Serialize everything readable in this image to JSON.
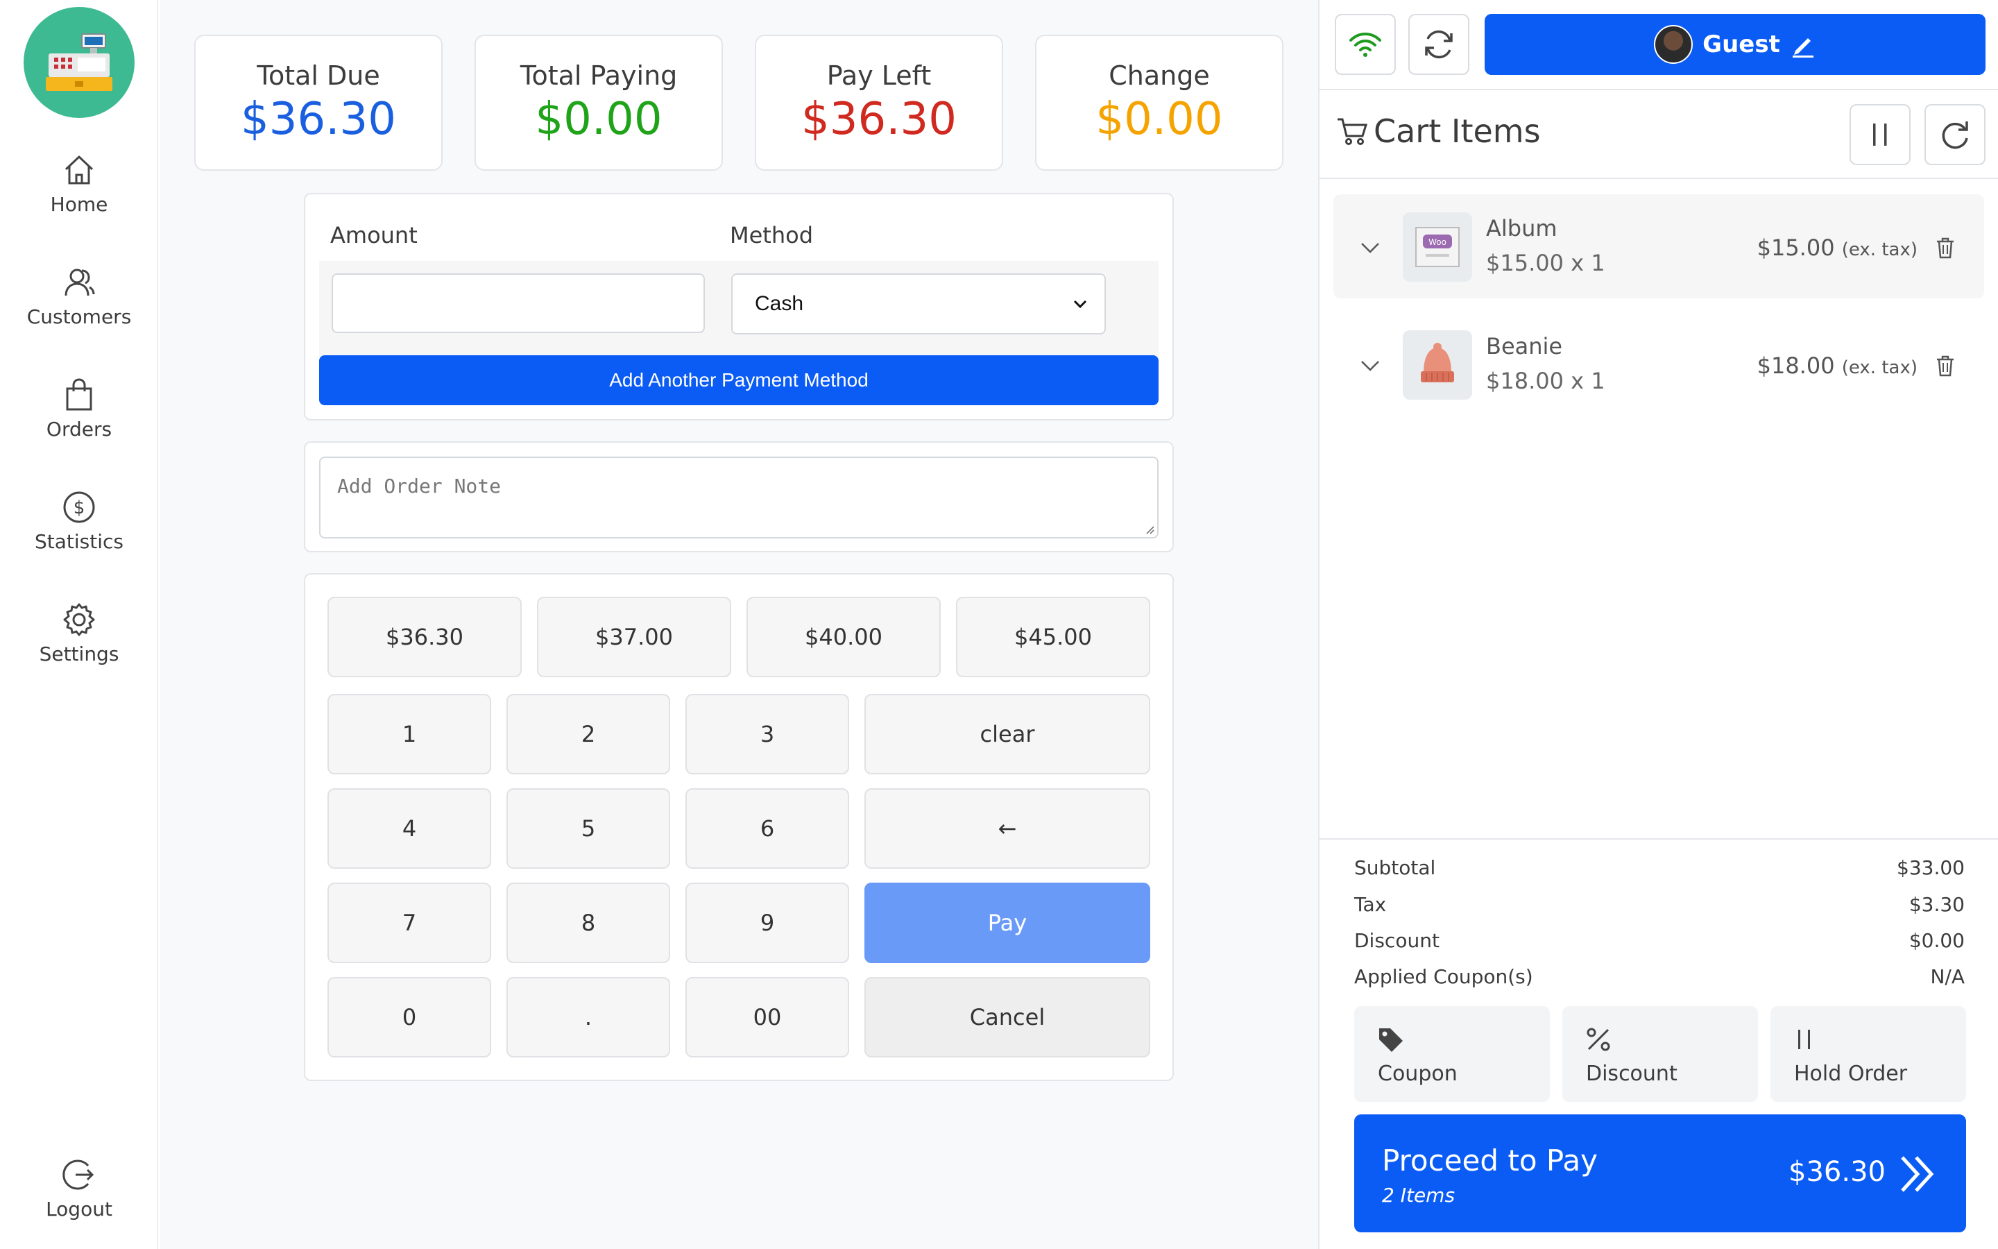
{
  "nav": {
    "items": [
      {
        "label": "Home"
      },
      {
        "label": "Customers"
      },
      {
        "label": "Orders"
      },
      {
        "label": "Statistics"
      },
      {
        "label": "Settings"
      }
    ],
    "logout": "Logout"
  },
  "summary": [
    {
      "label": "Total Due",
      "value": "$36.30",
      "color": "#1a5fe0"
    },
    {
      "label": "Total Paying",
      "value": "$0.00",
      "color": "#1fa319"
    },
    {
      "label": "Pay Left",
      "value": "$36.30",
      "color": "#d02a20"
    },
    {
      "label": "Change",
      "value": "$0.00",
      "color": "#f5a300"
    }
  ],
  "payment": {
    "amount_label": "Amount",
    "method_label": "Method",
    "amount_value": "",
    "method_selected": "Cash",
    "add_method_label": "Add Another Payment Method"
  },
  "order_note": {
    "placeholder": "Add Order Note"
  },
  "quick_amounts": [
    "$36.30",
    "$37.00",
    "$40.00",
    "$45.00"
  ],
  "keypad": {
    "digits": [
      "1",
      "2",
      "3",
      "4",
      "5",
      "6",
      "7",
      "8",
      "9",
      "0",
      ".",
      "00"
    ],
    "clear": "clear",
    "backspace": "←",
    "pay": "Pay",
    "cancel": "Cancel"
  },
  "header": {
    "guest_label": "Guest"
  },
  "cart": {
    "title": "Cart Items",
    "items": [
      {
        "name": "Album",
        "qty": "$15.00 x 1",
        "price": "$15.00",
        "tax_note": "(ex. tax)"
      },
      {
        "name": "Beanie",
        "qty": "$18.00 x 1",
        "price": "$18.00",
        "tax_note": "(ex. tax)"
      }
    ]
  },
  "totals": [
    {
      "label": "Subtotal",
      "value": "$33.00"
    },
    {
      "label": "Tax",
      "value": "$3.30"
    },
    {
      "label": "Discount",
      "value": "$0.00"
    },
    {
      "label": "Applied Coupon(s)",
      "value": "N/A"
    }
  ],
  "actions": {
    "coupon": "Coupon",
    "discount": "Discount",
    "hold": "Hold Order"
  },
  "proceed": {
    "label": "Proceed to Pay",
    "items": "2 Items",
    "amount": "$36.30"
  },
  "colors": {
    "accent": "#0b5cf4",
    "logo": "#3dba92",
    "wifi": "#1f9a1f"
  }
}
